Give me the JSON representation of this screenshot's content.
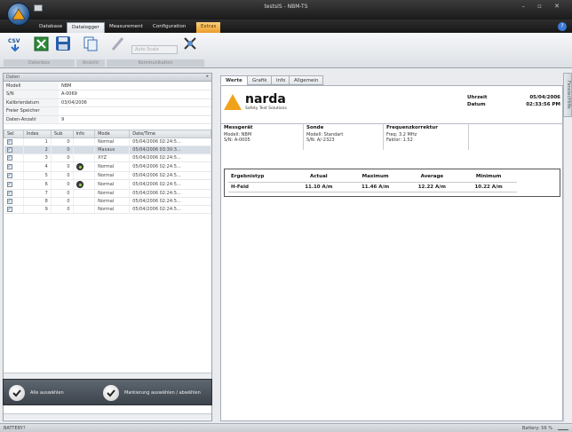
{
  "window": {
    "title": "testsIS - NBM-TS",
    "controls": "–  ▫  ✕"
  },
  "menu_tabs": [
    "Database",
    "Datalogger",
    "Measurement",
    "Configuration",
    "Extras"
  ],
  "active_tab": "Datalogger",
  "ribbon": {
    "combo_placeholder": "Auto Scale",
    "groups": [
      "Datenbox",
      "Ansicht",
      "Kommunikation"
    ]
  },
  "left_panel": {
    "header": "Daten",
    "properties": [
      {
        "key": "Modell",
        "value": "NBM"
      },
      {
        "key": "S/N",
        "value": "A-0069"
      },
      {
        "key": "Kalibrierdatum",
        "value": "03/04/2006"
      },
      {
        "key": "Freier Speicher",
        "value": ""
      },
      {
        "key": "Daten-Anzahl",
        "value": "9"
      }
    ],
    "grid_headers": [
      "Sel",
      "Index",
      "Sub",
      "Info",
      "Mode",
      "Date/Time"
    ],
    "rows": [
      {
        "index": "1",
        "sub": "0",
        "info": false,
        "mode": "Normal",
        "dt": "05/04/2006 02:24:5..."
      },
      {
        "index": "2",
        "sub": "0",
        "info": false,
        "mode": "Maxaus",
        "dt": "05/04/2006 03:30:3..."
      },
      {
        "index": "3",
        "sub": "0",
        "info": false,
        "mode": "XYZ",
        "dt": "05/04/2006 02:24:5..."
      },
      {
        "index": "4",
        "sub": "0",
        "info": true,
        "mode": "Normal",
        "dt": "05/04/2006 02:24:5..."
      },
      {
        "index": "5",
        "sub": "0",
        "info": false,
        "mode": "Normal",
        "dt": "05/04/2006 02:24:5..."
      },
      {
        "index": "6",
        "sub": "0",
        "info": true,
        "mode": "Normal",
        "dt": "05/04/2006 02:24:5..."
      },
      {
        "index": "7",
        "sub": "0",
        "info": false,
        "mode": "Normal",
        "dt": "05/04/2006 02:24:5..."
      },
      {
        "index": "8",
        "sub": "0",
        "info": false,
        "mode": "Normal",
        "dt": "05/04/2006 02:24:5..."
      },
      {
        "index": "9",
        "sub": "0",
        "info": false,
        "mode": "Normal",
        "dt": "05/04/2006 02:24:5..."
      }
    ],
    "select_all": "Alle auswählen",
    "select_markers": "Markierung auswählen / abwählen"
  },
  "right_panel": {
    "view_tabs": [
      "Werte",
      "Grafik",
      "Info",
      "Allgemein"
    ],
    "active_view": "Werte",
    "logo_text": "narda",
    "logo_sub": "Safety Test Solutions",
    "meta": {
      "uhrzeit_label": "Uhrzeit",
      "datum_label": "Datum",
      "datum": "05/04/2006",
      "uhrzeit": "02:33:56 PM"
    },
    "messgeraet": {
      "title": "Messgerät",
      "modell": "Modell:  NBM",
      "sn": "S/N:    A-0005"
    },
    "sonde": {
      "title": "Sonde",
      "modell": "Modell:  Standart",
      "sn": "S/N:    A/-2323"
    },
    "frequenz": {
      "title": "Frequenzkorrektur",
      "freq": "Freq:   3.2 MHz",
      "faktor": "Faktor:  1.52"
    },
    "results": {
      "headers": [
        "Ergebnistyp",
        "Actual",
        "Maximum",
        "Average",
        "Minimum"
      ],
      "row": [
        "H-Feld",
        "11.10 A/m",
        "11.46 A/m",
        "12.22 A/m",
        "10.22 A/m"
      ]
    },
    "side_tab": "Fenster/Hilfe"
  },
  "status": {
    "left": "BATTERY?",
    "right": "Battery: 56 %"
  }
}
